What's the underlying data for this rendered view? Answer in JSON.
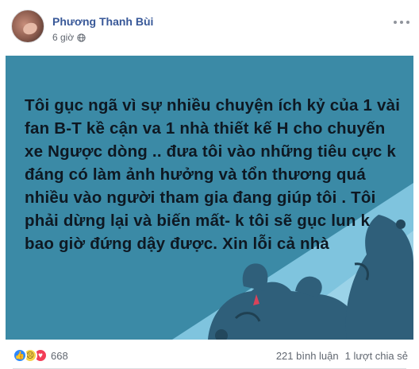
{
  "post": {
    "author": "Phương Thanh Bùi",
    "time": "6 giờ",
    "text": "Tôi gục ngã vì sự nhiều chuyện ích kỷ của 1 vài fan B-T kề cận va 1 nhà thiết kế H cho chuyến xe Ngược dòng .. đưa tôi vào những tiêu cực k đáng có làm ảnh hưởng và tổn thương quá nhiều vào người tham gia đang giúp tôi . Tôi phải dừng lại và biến mất- k tôi sẽ gục lun k bao giờ đứng dậy được. Xin lỗi cả nhà",
    "image_bg_color": "#3b8aa6"
  },
  "footer": {
    "reaction_count": "668",
    "comments": "221 bình luận",
    "shares": "1 lượt chia sẻ",
    "reaction_icons": [
      "like-icon",
      "sad-icon",
      "love-icon"
    ]
  }
}
